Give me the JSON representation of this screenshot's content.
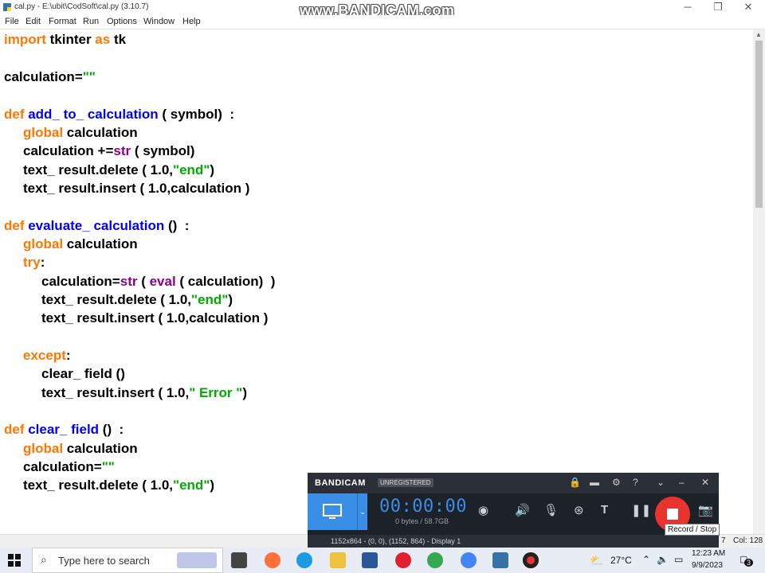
{
  "window": {
    "title": "cal.py - E:\\ubit\\CodSoft\\cal.py (3.10.7)",
    "minimize": "─",
    "restore": "❐",
    "close": "✕"
  },
  "watermark": "www.BANDICAM.com",
  "menu": [
    "File",
    "Edit",
    "Format",
    "Run",
    "Options",
    "Window",
    "Help"
  ],
  "code": {
    "l1": {
      "a": "import",
      "b": " tkinter ",
      "c": "as",
      "d": " tk"
    },
    "l2": {
      "a": "calculation=",
      "b": "\"\""
    },
    "l3": {
      "a": "def",
      "b": " add_ to_ calculation",
      "c": " ( symbol)  :"
    },
    "l4": {
      "a": "global",
      "b": " calculation"
    },
    "l5": {
      "a": "calculation +=",
      "b": "str",
      "c": " ( symbol)"
    },
    "l6": {
      "a": "text_ result.delete ( 1.0,",
      "b": "\"end\"",
      "c": ")"
    },
    "l7": {
      "a": "text_ result.insert ( 1.0,calculation )"
    },
    "l8": {
      "a": "def",
      "b": " evaluate_ calculation",
      "c": " ()  :"
    },
    "l9": {
      "a": "global",
      "b": " calculation"
    },
    "l10": {
      "a": "try",
      "b": ":"
    },
    "l11": {
      "a": "calculation=",
      "b": "str",
      "c": " ( ",
      "d": "eval",
      "e": " ( calculation)  )"
    },
    "l12": {
      "a": "text_ result.delete ( 1.0,",
      "b": "\"end\"",
      "c": ")"
    },
    "l13": {
      "a": "text_ result.insert ( 1.0,calculation )"
    },
    "l14": {
      "a": "except",
      "b": ":"
    },
    "l15": {
      "a": "clear_ field ()"
    },
    "l16": {
      "a": "text_ result.insert ( 1.0,",
      "b": "\" Error \"",
      "c": ")"
    },
    "l17": {
      "a": "def",
      "b": " clear_ field",
      "c": " ()  :"
    },
    "l18": {
      "a": "global",
      "b": " calculation"
    },
    "l19": {
      "a": "calculation=",
      "b": "\"\""
    },
    "l20": {
      "a": "text_ result.delete ( 1.0,",
      "b": "\"end\"",
      "c": ")"
    }
  },
  "status": {
    "ln": "7",
    "col": "Col: 128"
  },
  "bandicam": {
    "logo": "BANDICAM",
    "registered": "UNREGISTERED",
    "timer": "00:00:00",
    "size": "0 bytes / 58.7GB",
    "footer": "1152x864 - (0, 0), (1152, 864) - Display 1",
    "tooltip": "Record / Stop"
  },
  "taskbar": {
    "search_placeholder": "Type here to search",
    "weather": "27°C",
    "time": "12:23 AM",
    "date": "9/9/2023",
    "notif": "3"
  }
}
